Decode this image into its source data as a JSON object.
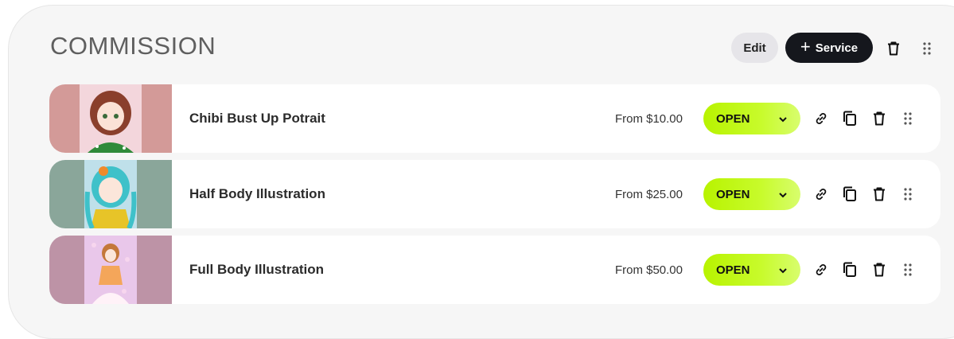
{
  "section": {
    "title": "COMMISSION",
    "edit_label": "Edit",
    "add_service_label": "Service",
    "icons": [
      "plus-icon",
      "trash-icon",
      "drag-handle-icon"
    ]
  },
  "services": [
    {
      "name": "Chibi Bust Up Potrait",
      "price": "From $10.00",
      "status": "OPEN",
      "thumb_bg": "#d39a98",
      "thumb_art": "#f3d6dc"
    },
    {
      "name": "Half Body Illustration",
      "price": "From $25.00",
      "status": "OPEN",
      "thumb_bg": "#8aa69a",
      "thumb_art": "#bfe0ea"
    },
    {
      "name": "Full Body Illustration",
      "price": "From $50.00",
      "status": "OPEN",
      "thumb_bg": "#bd93a6",
      "thumb_art": "#e9c7ea"
    }
  ],
  "row_icons": [
    "link-icon",
    "copy-icon",
    "trash-icon",
    "drag-handle-icon",
    "chevron-down-icon"
  ],
  "colors": {
    "status_open": "#c2f71a",
    "primary_button": "#15171d",
    "secondary_button": "#e6e5e9"
  }
}
